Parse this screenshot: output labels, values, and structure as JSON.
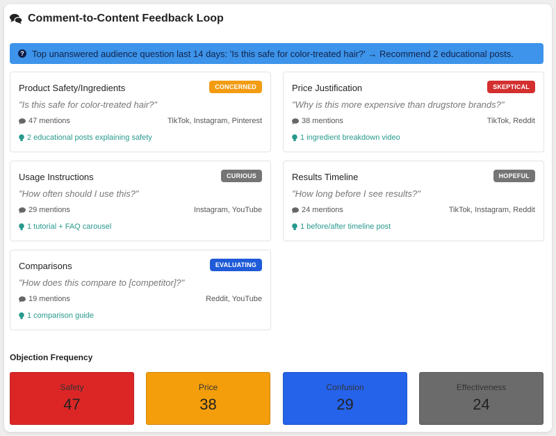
{
  "header": {
    "title": "Comment-to-Content Feedback Loop",
    "icon": "comments-icon"
  },
  "banner": {
    "icon": "question-circle-icon",
    "text": "Top unanswered audience question last 14 days: 'Is this safe for color-treated hair?' → Recommend 2 educational posts."
  },
  "cards": [
    {
      "title": "Product Safety/Ingredients",
      "badge": "CONCERNED",
      "badge_color": "#f39c12",
      "quote": "\"Is this safe for color-treated hair?\"",
      "mentions": "47 mentions",
      "platforms": "TikTok, Instagram, Pinterest",
      "recommendation": "2 educational posts explaining safety"
    },
    {
      "title": "Price Justification",
      "badge": "SKEPTICAL",
      "badge_color": "#d32f2f",
      "quote": "\"Why is this more expensive than drugstore brands?\"",
      "mentions": "38 mentions",
      "platforms": "TikTok, Reddit",
      "recommendation": "1 ingredient breakdown video"
    },
    {
      "title": "Usage Instructions",
      "badge": "CURIOUS",
      "badge_color": "#757575",
      "quote": "\"How often should I use this?\"",
      "mentions": "29 mentions",
      "platforms": "Instagram, YouTube",
      "recommendation": "1 tutorial + FAQ carousel"
    },
    {
      "title": "Results Timeline",
      "badge": "HOPEFUL",
      "badge_color": "#757575",
      "quote": "\"How long before I see results?\"",
      "mentions": "24 mentions",
      "platforms": "TikTok, Instagram, Reddit",
      "recommendation": "1 before/after timeline post"
    },
    {
      "title": "Comparisons",
      "badge": "EVALUATING",
      "badge_color": "#1f5bd8",
      "quote": "\"How does this compare to [competitor]?\"",
      "mentions": "19 mentions",
      "platforms": "Reddit, YouTube",
      "recommendation": "1 comparison guide"
    }
  ],
  "objection_frequency": {
    "title": "Objection Frequency",
    "items": [
      {
        "label": "Safety",
        "value": "47",
        "color": "#dc2626"
      },
      {
        "label": "Price",
        "value": "38",
        "color": "#f59e0b"
      },
      {
        "label": "Confusion",
        "value": "29",
        "color": "#2563eb"
      },
      {
        "label": "Effectiveness",
        "value": "24",
        "color": "#6b6b6b"
      }
    ]
  }
}
